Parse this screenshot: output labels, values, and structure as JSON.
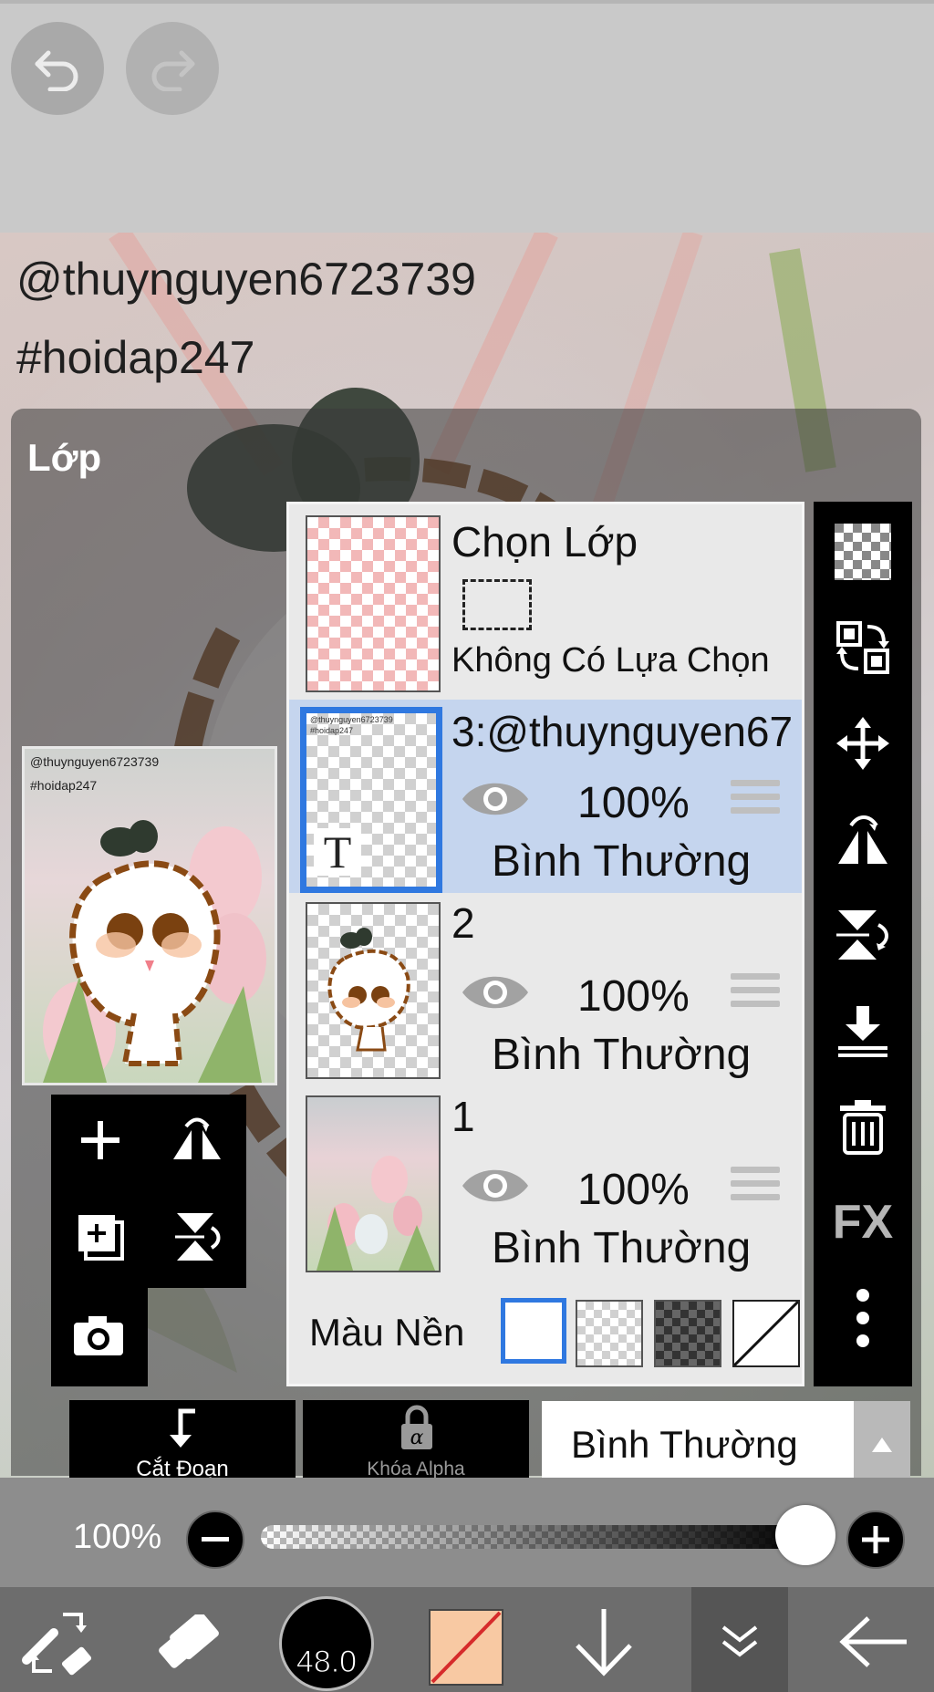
{
  "top_bar": {
    "undo_icon": "undo-arrow-icon",
    "redo_icon": "redo-arrow-icon"
  },
  "canvas": {
    "text_line1": "@thuynguyen6723739",
    "text_line2": "#hoidap247"
  },
  "panel": {
    "title": "Lớp",
    "preview_text1": "@thuynguyen6723739",
    "preview_text2": "#hoidap247"
  },
  "selection_row": {
    "title": "Chọn Lớp",
    "status": "Không Có Lựa Chọn"
  },
  "layers": [
    {
      "name": "3:@thuynguyen67",
      "opacity": "100%",
      "blend": "Bình Thường",
      "selected": true,
      "thumb_label": "T",
      "thumb_text1": "@thuynguyen6723739",
      "thumb_text2": "#hoidap247"
    },
    {
      "name": "2",
      "opacity": "100%",
      "blend": "Bình Thường",
      "selected": false
    },
    {
      "name": "1",
      "opacity": "100%",
      "blend": "Bình Thường",
      "selected": false
    }
  ],
  "background_color": {
    "label": "Màu Nền"
  },
  "right_toolbar": {
    "fx_label": "FX"
  },
  "bottom_controls": {
    "clip_label": "Cắt Đoạn",
    "alpha_lock_label": "Khóa Alpha",
    "blend_mode": "Bình Thường",
    "opacity_label": "100%",
    "opacity_value": 1.0
  },
  "bottom_toolbar": {
    "brush_size": "48.0"
  },
  "colors": {
    "selected_row": "#c5d5ee",
    "accent_blue": "#2f78e0",
    "current_color": "#f8c9a3"
  }
}
